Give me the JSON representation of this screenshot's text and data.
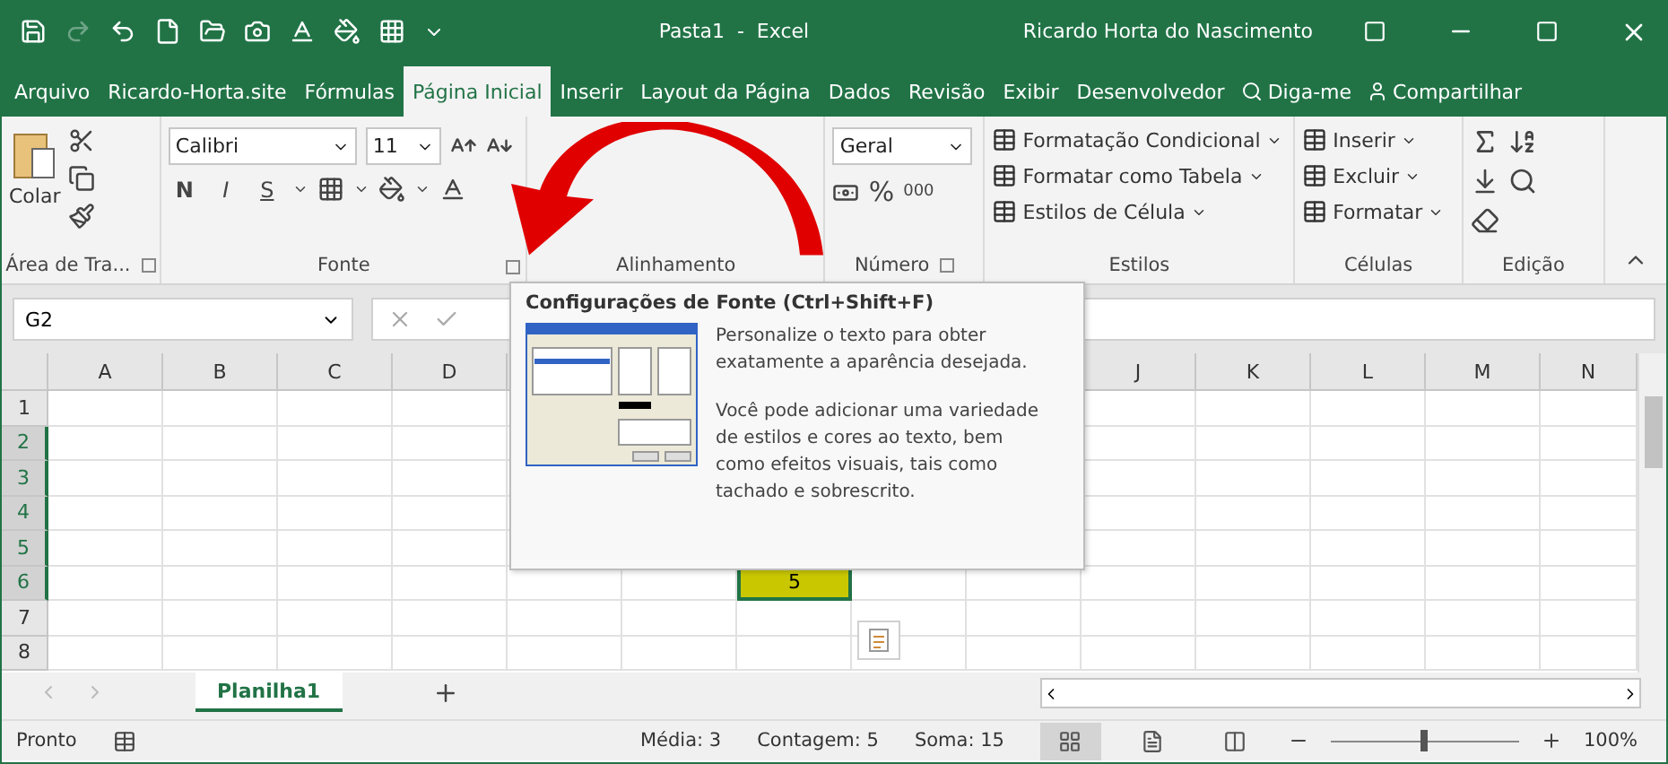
{
  "title_bar": {
    "title": "Pasta1  -  Excel",
    "user": "Ricardo Horta do Nascimento"
  },
  "tabs": [
    {
      "label": "Arquivo",
      "selected": false
    },
    {
      "label": "Ricardo-Horta.site",
      "selected": false
    },
    {
      "label": "Fórmulas",
      "selected": false
    },
    {
      "label": "Página Inicial",
      "selected": true
    },
    {
      "label": "Inserir",
      "selected": false
    },
    {
      "label": "Layout da Página",
      "selected": false
    },
    {
      "label": "Dados",
      "selected": false
    },
    {
      "label": "Revisão",
      "selected": false
    },
    {
      "label": "Exibir",
      "selected": false
    },
    {
      "label": "Desenvolvedor",
      "selected": false
    }
  ],
  "tell_me": "Diga-me",
  "share": "Compartilhar",
  "clipboard": {
    "paste": "Colar",
    "label": "Área de Tra..."
  },
  "font": {
    "name": "Calibri",
    "size": "11",
    "styles": [
      "N",
      "I",
      "S"
    ],
    "label": "Fonte"
  },
  "alignment": {
    "label": "Alinhamento"
  },
  "number": {
    "format": "Geral",
    "percent": "%",
    "thousands": "000",
    "label": "Número"
  },
  "styles": {
    "items": [
      "Formatação Condicional",
      "Formatar como Tabela",
      "Estilos de Célula"
    ],
    "label": "Estilos"
  },
  "cells": {
    "items": [
      "Inserir",
      "Excluir",
      "Formatar"
    ],
    "label": "Células"
  },
  "editing": {
    "label": "Edição"
  },
  "formula_bar": {
    "name_box": "G2"
  },
  "grid": {
    "columns_left": [
      "A",
      "B",
      "C",
      "D"
    ],
    "columns_right": [
      "J",
      "K",
      "L",
      "M",
      "N"
    ],
    "rows": [
      {
        "label": "1",
        "selected": false
      },
      {
        "label": "2",
        "selected": true
      },
      {
        "label": "3",
        "selected": true
      },
      {
        "label": "4",
        "selected": true
      },
      {
        "label": "5",
        "selected": true
      },
      {
        "label": "6",
        "selected": true,
        "value": "5"
      },
      {
        "label": "7",
        "selected": false
      },
      {
        "label": "8",
        "selected": false
      }
    ]
  },
  "tooltip": {
    "title": "Configurações de Fonte (Ctrl+Shift+F)",
    "paragraphs": [
      "Personalize o texto para obter exatamente a aparência desejada.",
      "Você pode adicionar uma variedade de estilos e cores ao texto, bem como efeitos visuais, tais como tachado e sobrescrito."
    ]
  },
  "sheets": [
    {
      "name": "Planilha1",
      "selected": true
    }
  ],
  "status_bar": {
    "mode": "Pronto",
    "stats": [
      "Média: 3",
      "Contagem: 5",
      "Soma: 15"
    ],
    "views": [
      {
        "kind": "normal",
        "selected": true
      },
      {
        "kind": "page_layout",
        "selected": false
      },
      {
        "kind": "page_break",
        "selected": false
      }
    ],
    "zoom": {
      "level": 0.5,
      "reading": "100%"
    }
  }
}
